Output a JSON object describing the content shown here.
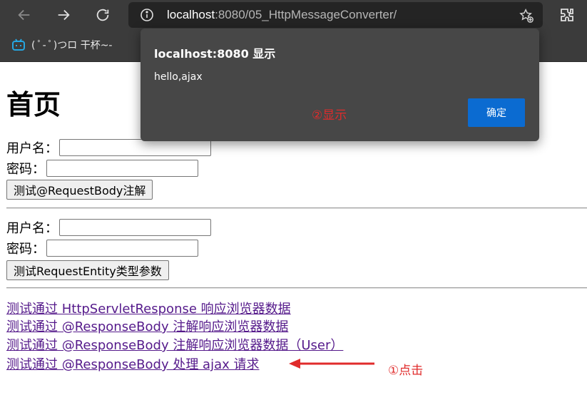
{
  "browser": {
    "url_host": "localhost",
    "url_rest": ":8080/05_HttpMessageConverter/",
    "bookmark_label": "( ﾟ- ﾟ)つロ 干杯~-"
  },
  "page": {
    "heading": "首页",
    "form1": {
      "username_label": "用户名：",
      "username_value": "",
      "password_label": "密码：",
      "password_value": "",
      "submit_label": "测试@RequestBody注解"
    },
    "form2": {
      "username_label": "用户名：",
      "username_value": "",
      "password_label": "密码：",
      "password_value": "",
      "submit_label": "测试RequestEntity类型参数"
    },
    "links": [
      "测试通过 HttpServletResponse 响应浏览器数据",
      "测试通过 @ResponseBody 注解响应浏览器数据",
      "测试通过 @ResponseBody 注解响应浏览器数据（User）",
      "测试通过 @ResponseBody 处理 ajax 请求"
    ]
  },
  "annotations": {
    "click": "①点击",
    "display": "②显示"
  },
  "dialog": {
    "title": "localhost:8080 显示",
    "message": "hello,ajax",
    "ok_label": "确定"
  },
  "colors": {
    "annotation": "#e02b2b",
    "dialog_bg": "#474747",
    "ok_button": "#0b6bd1",
    "link": "#551a8b"
  }
}
